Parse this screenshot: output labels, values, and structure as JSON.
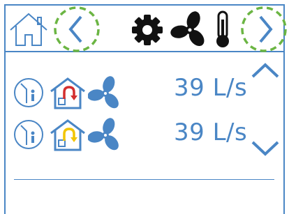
{
  "header": {
    "icons": [
      "home-icon",
      "chevron-left-icon",
      "gear-icon",
      "fan-icon",
      "thermometer-icon",
      "chevron-right-icon"
    ]
  },
  "rows": [
    {
      "icons": [
        "person-in-room-icon",
        "house-recirculation-icon",
        "fan-icon"
      ],
      "flow": "39 L/s",
      "arrow_color": "#d32f2f"
    },
    {
      "icons": [
        "person-in-room-icon",
        "house-bypass-icon",
        "fan-icon"
      ],
      "flow": "39 L/s",
      "arrow_color": "#f2c500"
    }
  ],
  "colors": {
    "accent": "#4a86c5",
    "highlight": "#6bb543",
    "icon_dark": "#111111"
  }
}
